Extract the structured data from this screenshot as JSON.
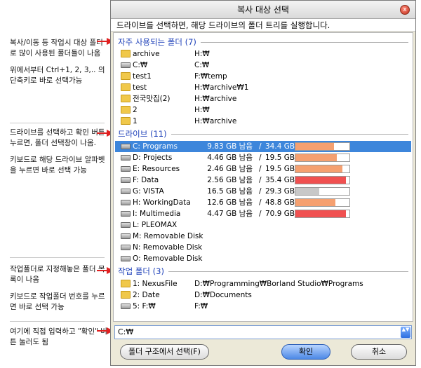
{
  "annotations": {
    "favorites": [
      "복사/이동 등 작업시 대상 폴더로 많이 사용된 폴더들이 나옴",
      "위에서부터 Ctrl+1, 2, 3,.. 의 단축키로 바로 선택가능"
    ],
    "drives": [
      "드라이브를 선택하고 확인 버튼 누르면, 폴더 선택창이 나옴.",
      "키보드로 해당 드라이브 알파벳을 누르면 바로 선택 가능"
    ],
    "work": [
      "작업폴더로 지정해놓은 폴더 목록이 나옴",
      "키보드로 작업폴더 번호를 누르면 바로 선택 가능"
    ],
    "input": [
      "여기에 직접 입력하고 \"확인\" 버튼 눌러도 됨"
    ]
  },
  "dialog": {
    "title": "복사 대상 선택",
    "subtitle": "드라이브를 선택하면, 해당 드라이브의 폴더 트리를 실행합니다.",
    "close_glyph": "x"
  },
  "sections": {
    "favorites": {
      "label": "자주 사용되는 폴더",
      "count": "(7)",
      "items": [
        {
          "name": "archive",
          "path": "H:₩",
          "icon": "folder"
        },
        {
          "name": "C:₩",
          "path": "C:₩",
          "icon": "drive"
        },
        {
          "name": "test1",
          "path": "F:₩temp",
          "icon": "folder"
        },
        {
          "name": "test",
          "path": "H:₩archive₩1",
          "icon": "folder"
        },
        {
          "name": "전국맛집(2)",
          "path": "H:₩archive",
          "icon": "folder"
        },
        {
          "name": "2",
          "path": "H:₩",
          "icon": "folder"
        },
        {
          "name": "1",
          "path": "H:₩archive",
          "icon": "folder"
        }
      ]
    },
    "drives": {
      "label": "드라이브",
      "count": "(11)",
      "items": [
        {
          "name": "C: Programs",
          "free": "9.83 GB 남음",
          "slash": "/",
          "total": "34.4 GB",
          "used_fraction": 0.71,
          "color": "#f5a070",
          "selected": true
        },
        {
          "name": "D: Projects",
          "free": "4.46 GB 남음",
          "slash": "/",
          "total": "19.5 GB",
          "used_fraction": 0.77,
          "color": "#f5a070"
        },
        {
          "name": "E: Resources",
          "free": "2.46 GB 남음",
          "slash": "/",
          "total": "19.5 GB",
          "used_fraction": 0.87,
          "color": "#f5a070"
        },
        {
          "name": "F: Data",
          "free": "2.56 GB 남음",
          "slash": "/",
          "total": "35.4 GB",
          "used_fraction": 0.93,
          "color": "#f05050"
        },
        {
          "name": "G: VISTA",
          "free": "16.5 GB 남음",
          "slash": "/",
          "total": "29.3 GB",
          "used_fraction": 0.44,
          "color": "#c8c8c8"
        },
        {
          "name": "H: WorkingData",
          "free": "12.6 GB 남음",
          "slash": "/",
          "total": "48.8 GB",
          "used_fraction": 0.74,
          "color": "#f5a070"
        },
        {
          "name": "I: Multimedia",
          "free": "4.47 GB 남음",
          "slash": "/",
          "total": "70.9 GB",
          "used_fraction": 0.94,
          "color": "#f05050"
        },
        {
          "name": "L: PLEOMAX"
        },
        {
          "name": "M: Removable Disk"
        },
        {
          "name": "N: Removable Disk"
        },
        {
          "name": "O: Removable Disk"
        }
      ]
    },
    "work": {
      "label": "작업 폴더",
      "count": "(3)",
      "items": [
        {
          "name": "1: NexusFile",
          "path": "D:₩Programming₩Borland Studio₩Programs",
          "icon": "folder"
        },
        {
          "name": "2: Date",
          "path": "D:₩Documents",
          "icon": "folder"
        },
        {
          "name": "5: F:₩",
          "path": "F:₩",
          "icon": "drive"
        }
      ]
    }
  },
  "input": {
    "value": "C:₩",
    "spin_glyph": "▲▼"
  },
  "buttons": {
    "browse": "폴더 구조에서 선택(F)",
    "ok": "확인",
    "cancel": "취소"
  },
  "colors": {
    "accent": "#1c3fb8",
    "selection": "#3d86db",
    "arrow": "#e02020"
  }
}
